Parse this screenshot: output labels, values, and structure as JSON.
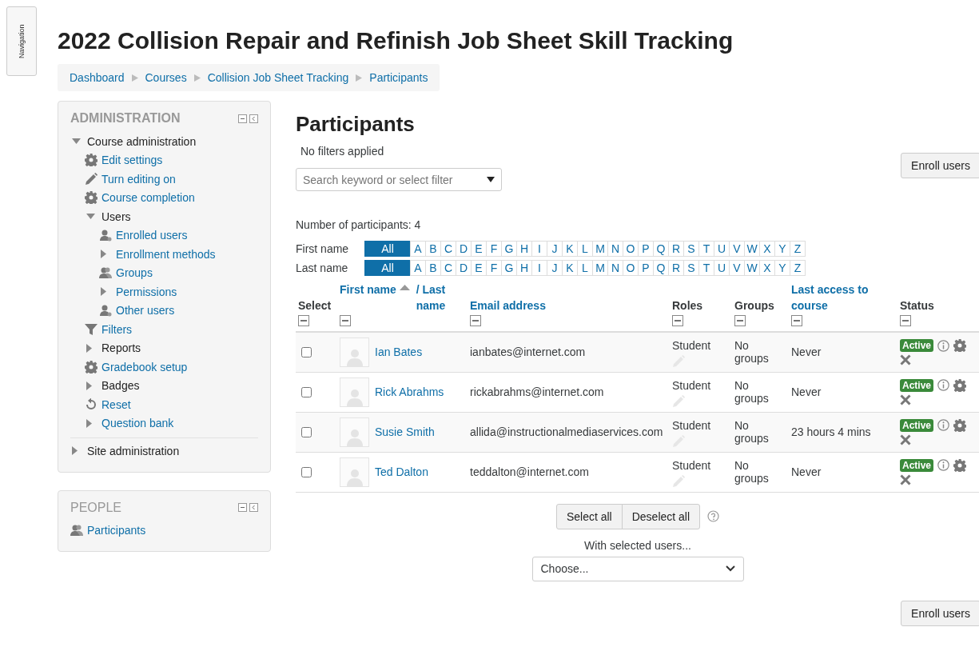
{
  "nav_drawer": {
    "label": "Navigation"
  },
  "page_title": "2022 Collision Repair and Refinish Job Sheet Skill Tracking",
  "breadcrumb": [
    "Dashboard",
    "Courses",
    "Collision Job Sheet Tracking",
    "Participants"
  ],
  "blocks": [
    {
      "title": "ADMINISTRATION",
      "items": [
        {
          "label": "Course administration",
          "kind": "branch",
          "expanded": true,
          "link": false,
          "children": [
            {
              "label": "Edit settings",
              "kind": "gear",
              "link": true
            },
            {
              "label": "Turn editing on",
              "kind": "pencil",
              "link": true
            },
            {
              "label": "Course completion",
              "kind": "gear",
              "link": true
            },
            {
              "label": "Users",
              "kind": "branch",
              "expanded": true,
              "link": false,
              "children": [
                {
                  "label": "Enrolled users",
                  "kind": "user",
                  "link": true
                },
                {
                  "label": "Enrollment methods",
                  "kind": "branch",
                  "expanded": false,
                  "link": true
                },
                {
                  "label": "Groups",
                  "kind": "group",
                  "link": true
                },
                {
                  "label": "Permissions",
                  "kind": "branch",
                  "expanded": false,
                  "link": true
                },
                {
                  "label": "Other users",
                  "kind": "user",
                  "link": true
                }
              ]
            },
            {
              "label": "Filters",
              "kind": "funnel",
              "link": true
            },
            {
              "label": "Reports",
              "kind": "branch",
              "expanded": false,
              "link": false
            },
            {
              "label": "Gradebook setup",
              "kind": "gear",
              "link": true
            },
            {
              "label": "Badges",
              "kind": "branch",
              "expanded": false,
              "link": false
            },
            {
              "label": "Reset",
              "kind": "reset",
              "link": true
            },
            {
              "label": "Question bank",
              "kind": "branch",
              "expanded": false,
              "link": true
            }
          ]
        },
        {
          "label": "Site administration",
          "kind": "branch",
          "expanded": false,
          "link": false
        }
      ]
    },
    {
      "title": "PEOPLE",
      "items": [
        {
          "label": "Participants",
          "kind": "group",
          "link": true
        }
      ]
    }
  ],
  "main": {
    "heading": "Participants",
    "filter_status": "No filters applied",
    "filter_field": {
      "placeholder": "Search keyword or select filter"
    },
    "top_button": "Enroll users",
    "participant_count": "Number of participants: 4",
    "initials_bars": [
      {
        "label": "First name",
        "letters": [
          {
            "label": "All",
            "selected": true
          },
          {
            "label": "A",
            "selected": false
          },
          {
            "label": "B",
            "selected": false
          },
          {
            "label": "C",
            "selected": false
          },
          {
            "label": "D",
            "selected": false
          },
          {
            "label": "E",
            "selected": false
          },
          {
            "label": "F",
            "selected": false
          },
          {
            "label": "G",
            "selected": false
          },
          {
            "label": "H",
            "selected": false
          },
          {
            "label": "I",
            "selected": false
          },
          {
            "label": "J",
            "selected": false
          },
          {
            "label": "K",
            "selected": false
          },
          {
            "label": "L",
            "selected": false
          },
          {
            "label": "M",
            "selected": false
          },
          {
            "label": "N",
            "selected": false
          },
          {
            "label": "O",
            "selected": false
          },
          {
            "label": "P",
            "selected": false
          },
          {
            "label": "Q",
            "selected": false
          },
          {
            "label": "R",
            "selected": false
          },
          {
            "label": "S",
            "selected": false
          },
          {
            "label": "T",
            "selected": false
          },
          {
            "label": "U",
            "selected": false
          },
          {
            "label": "V",
            "selected": false
          },
          {
            "label": "W",
            "selected": false
          },
          {
            "label": "X",
            "selected": false
          },
          {
            "label": "Y",
            "selected": false
          },
          {
            "label": "Z",
            "selected": false
          }
        ]
      },
      {
        "label": "Last name",
        "letters": [
          {
            "label": "All",
            "selected": true
          },
          {
            "label": "A",
            "selected": false
          },
          {
            "label": "B",
            "selected": false
          },
          {
            "label": "C",
            "selected": false
          },
          {
            "label": "D",
            "selected": false
          },
          {
            "label": "E",
            "selected": false
          },
          {
            "label": "F",
            "selected": false
          },
          {
            "label": "G",
            "selected": false
          },
          {
            "label": "H",
            "selected": false
          },
          {
            "label": "I",
            "selected": false
          },
          {
            "label": "J",
            "selected": false
          },
          {
            "label": "K",
            "selected": false
          },
          {
            "label": "L",
            "selected": false
          },
          {
            "label": "M",
            "selected": false
          },
          {
            "label": "N",
            "selected": false
          },
          {
            "label": "O",
            "selected": false
          },
          {
            "label": "P",
            "selected": false
          },
          {
            "label": "Q",
            "selected": false
          },
          {
            "label": "R",
            "selected": false
          },
          {
            "label": "S",
            "selected": false
          },
          {
            "label": "T",
            "selected": false
          },
          {
            "label": "U",
            "selected": false
          },
          {
            "label": "V",
            "selected": false
          },
          {
            "label": "W",
            "selected": false
          },
          {
            "label": "X",
            "selected": false
          },
          {
            "label": "Y",
            "selected": false
          },
          {
            "label": "Z",
            "selected": false
          }
        ]
      }
    ],
    "table": {
      "columns": [
        {
          "labels": [
            "Select"
          ],
          "link": false,
          "sorted": false
        },
        {
          "labels": [
            "First name",
            "/ Last name"
          ],
          "link": true,
          "sorted": true
        },
        {
          "labels": [
            "Email address"
          ],
          "link": true,
          "sorted": false
        },
        {
          "labels": [
            "Roles"
          ],
          "link": false,
          "sorted": false
        },
        {
          "labels": [
            "Groups"
          ],
          "link": false,
          "sorted": false
        },
        {
          "labels": [
            "Last access to course"
          ],
          "link": true,
          "sorted": false
        },
        {
          "labels": [
            "Status"
          ],
          "link": false,
          "sorted": false
        }
      ],
      "rows": [
        {
          "checked": false,
          "name": "Ian Bates",
          "email": "ianbates@internet.com",
          "role": "Student",
          "groups": "No groups",
          "last_access": "Never",
          "status": "Active"
        },
        {
          "checked": false,
          "name": "Rick Abrahms",
          "email": "rickabrahms@internet.com",
          "role": "Student",
          "groups": "No groups",
          "last_access": "Never",
          "status": "Active"
        },
        {
          "checked": false,
          "name": "Susie Smith",
          "email": "allida@instructionalmediaservices.com",
          "role": "Student",
          "groups": "No groups",
          "last_access": "23 hours 4 mins",
          "status": "Active"
        },
        {
          "checked": false,
          "name": "Ted Dalton",
          "email": "teddalton@internet.com",
          "role": "Student",
          "groups": "No groups",
          "last_access": "Never",
          "status": "Active"
        }
      ]
    },
    "bulk_buttons": [
      "Select all",
      "Deselect all"
    ],
    "bulk_caption": "With selected users...",
    "bulk_select": {
      "value": "Choose..."
    },
    "bottom_button": "Enroll users"
  }
}
